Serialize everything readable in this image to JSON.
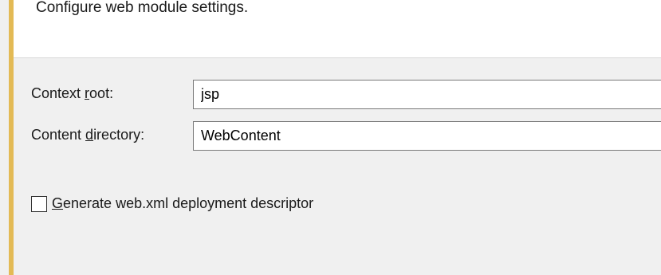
{
  "colors": {
    "accent_bar": "#e3ba55",
    "banner_bg": "#ffffff",
    "dialog_bg": "#f0f0f0",
    "input_border": "#7a7a7a"
  },
  "header": {
    "description": "Configure web module settings."
  },
  "form": {
    "context_root": {
      "label_prefix": "Context ",
      "label_mnemonic": "r",
      "label_suffix": "oot:",
      "value": "jsp"
    },
    "content_directory": {
      "label_prefix": "Content ",
      "label_mnemonic": "d",
      "label_suffix": "irectory:",
      "value": "WebContent"
    },
    "generate_descriptor": {
      "label_mnemonic": "G",
      "label_suffix": "enerate web.xml deployment descriptor",
      "checked": false
    }
  }
}
